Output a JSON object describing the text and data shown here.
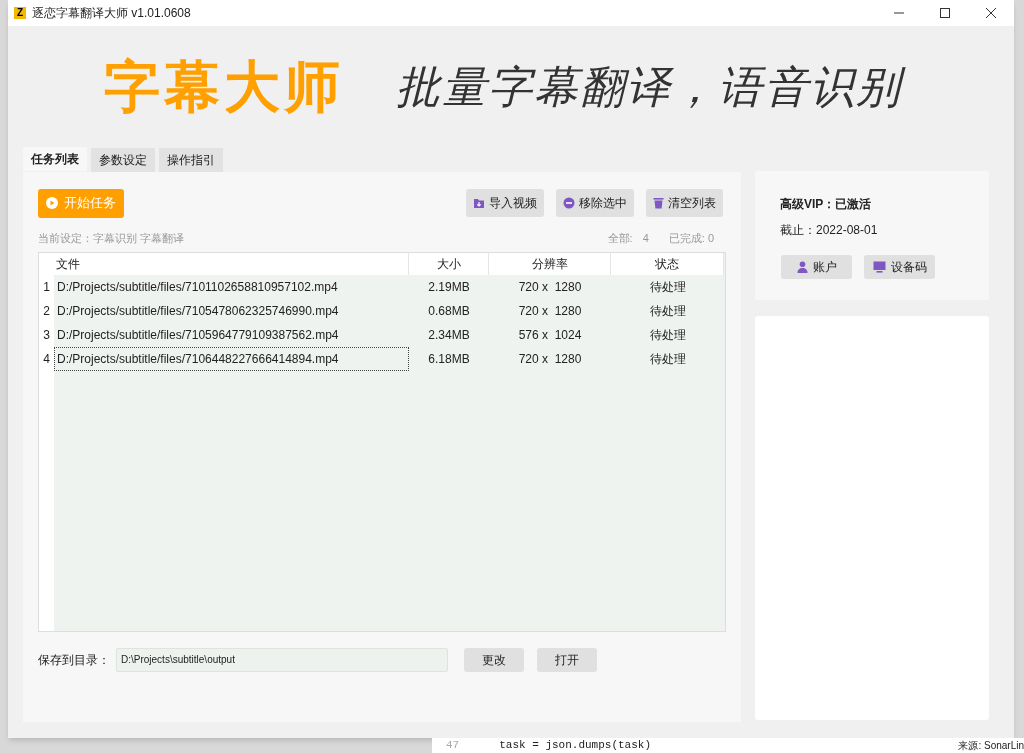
{
  "window": {
    "title": "逐恋字幕翻译大师 v1.01.0608",
    "app_icon_letter": "Z"
  },
  "banner": {
    "brand": "字幕大师",
    "slogan": "批量字幕翻译，语音识别"
  },
  "tabs": [
    {
      "label": "任务列表",
      "selected": true
    },
    {
      "label": "参数设定",
      "selected": false
    },
    {
      "label": "操作指引",
      "selected": false
    }
  ],
  "toolbar": {
    "start_button": "开始任务",
    "buttons": [
      {
        "label": "导入视频",
        "kind": "import"
      },
      {
        "label": "移除选中",
        "kind": "remove"
      },
      {
        "label": "清空列表",
        "kind": "clear"
      }
    ]
  },
  "current_settings": "当前设定：字幕识别 字幕翻译",
  "counts": {
    "total_label": "全部:",
    "total": "4",
    "done_label": "已完成: 0"
  },
  "table": {
    "columns": [
      "文件",
      "大小",
      "分辨率",
      "状态"
    ],
    "rows": [
      {
        "index": "1",
        "file": "D:/Projects/subtitle/files/7101102658810957102.mp4",
        "size": "2.19MB",
        "resolution": "720 x  1280",
        "status": "待处理",
        "selected": false
      },
      {
        "index": "2",
        "file": "D:/Projects/subtitle/files/7105478062325746990.mp4",
        "size": "0.68MB",
        "resolution": "720 x  1280",
        "status": "待处理",
        "selected": false
      },
      {
        "index": "3",
        "file": "D:/Projects/subtitle/files/7105964779109387562.mp4",
        "size": "2.34MB",
        "resolution": "576 x  1024",
        "status": "待处理",
        "selected": false
      },
      {
        "index": "4",
        "file": "D:/Projects/subtitle/files/7106448227666414894.mp4",
        "size": "6.18MB",
        "resolution": "720 x  1280",
        "status": "待处理",
        "selected": true
      }
    ]
  },
  "output": {
    "label": "保存到目录：",
    "path": "D:\\Projects\\subtitle\\output",
    "buttons": [
      "更改",
      "打开"
    ]
  },
  "vip": {
    "status": "高级VIP：已激活",
    "expiry": "截止：2022-08-01",
    "buttons": [
      {
        "label": "账户",
        "kind": "account"
      },
      {
        "label": "设备码",
        "kind": "device"
      }
    ]
  },
  "background": {
    "line_number": "47",
    "code": "task = json.dumps(task)",
    "source": "来源: SonarLin"
  }
}
